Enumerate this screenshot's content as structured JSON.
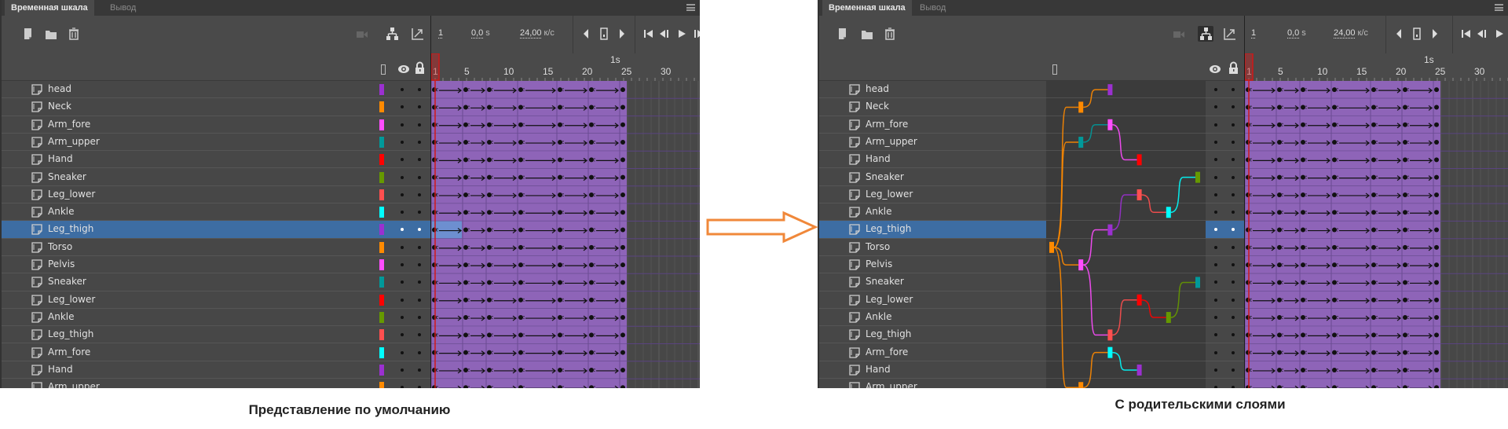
{
  "tabs": [
    "Временная шкала",
    "Вывод"
  ],
  "controls": {
    "frame": "1",
    "time": "0,0",
    "time_unit": "s",
    "fps": "24,00",
    "fps_unit": "к/с"
  },
  "toolbar_icons": [
    "new-layer-icon",
    "new-folder-icon",
    "delete-icon",
    "camera-icon",
    "show-parenting-view-icon",
    "graph-icon"
  ],
  "ruler": {
    "labels": [
      {
        "frame": 1,
        "text": "1"
      },
      {
        "frame": 5,
        "text": "5"
      },
      {
        "frame": 10,
        "text": "10"
      },
      {
        "frame": 15,
        "text": "15"
      },
      {
        "frame": 20,
        "text": "20"
      },
      {
        "frame": 25,
        "text": "25"
      },
      {
        "frame": 30,
        "text": "30"
      }
    ],
    "second_marker": {
      "frame": 24,
      "text": "1s"
    }
  },
  "current_frame": 1,
  "span_end_frame": 25,
  "keyframes": [
    1,
    5,
    8,
    12,
    17,
    21,
    25
  ],
  "selected_layer": 8,
  "layers": [
    {
      "name": "head",
      "color": "#9b30d0",
      "parent": 1
    },
    {
      "name": "Neck",
      "color": "#ff8a00",
      "parent": 9
    },
    {
      "name": "Arm_fore",
      "color": "#ff4dff",
      "parent": 3
    },
    {
      "name": "Arm_upper",
      "color": "#00999a",
      "parent": 9
    },
    {
      "name": "Hand",
      "color": "#ff0000",
      "parent": 2
    },
    {
      "name": "Sneaker",
      "color": "#669900",
      "parent": 7
    },
    {
      "name": "Leg_lower",
      "color": "#ff4f4f",
      "parent": 8
    },
    {
      "name": "Ankle",
      "color": "#00ffff",
      "parent": 6
    },
    {
      "name": "Leg_thigh",
      "color": "#9b30d0",
      "parent": 10
    },
    {
      "name": "Torso",
      "color": "#ff8a00",
      "parent": null
    },
    {
      "name": "Pelvis",
      "color": "#ff4dff",
      "parent": 9
    },
    {
      "name": "Sneaker",
      "color": "#00999a",
      "parent": 13
    },
    {
      "name": "Leg_lower",
      "color": "#ff0000",
      "parent": 14
    },
    {
      "name": "Ankle",
      "color": "#669900",
      "parent": 12
    },
    {
      "name": "Leg_thigh",
      "color": "#ff4f4f",
      "parent": 10
    },
    {
      "name": "Arm_fore",
      "color": "#00ffff",
      "parent": 17
    },
    {
      "name": "Hand",
      "color": "#9b30d0",
      "parent": 15
    },
    {
      "name": "Arm_upper",
      "color": "#ff8a00",
      "parent": 9
    }
  ],
  "colors": {
    "span": "#8e64b8",
    "playhead": "#d01818",
    "selection": "#3d6da3",
    "arrow": "#f0883a"
  },
  "captions": {
    "default_view": "Представление по умолчанию",
    "parent_view": "С родительскими слоями"
  }
}
